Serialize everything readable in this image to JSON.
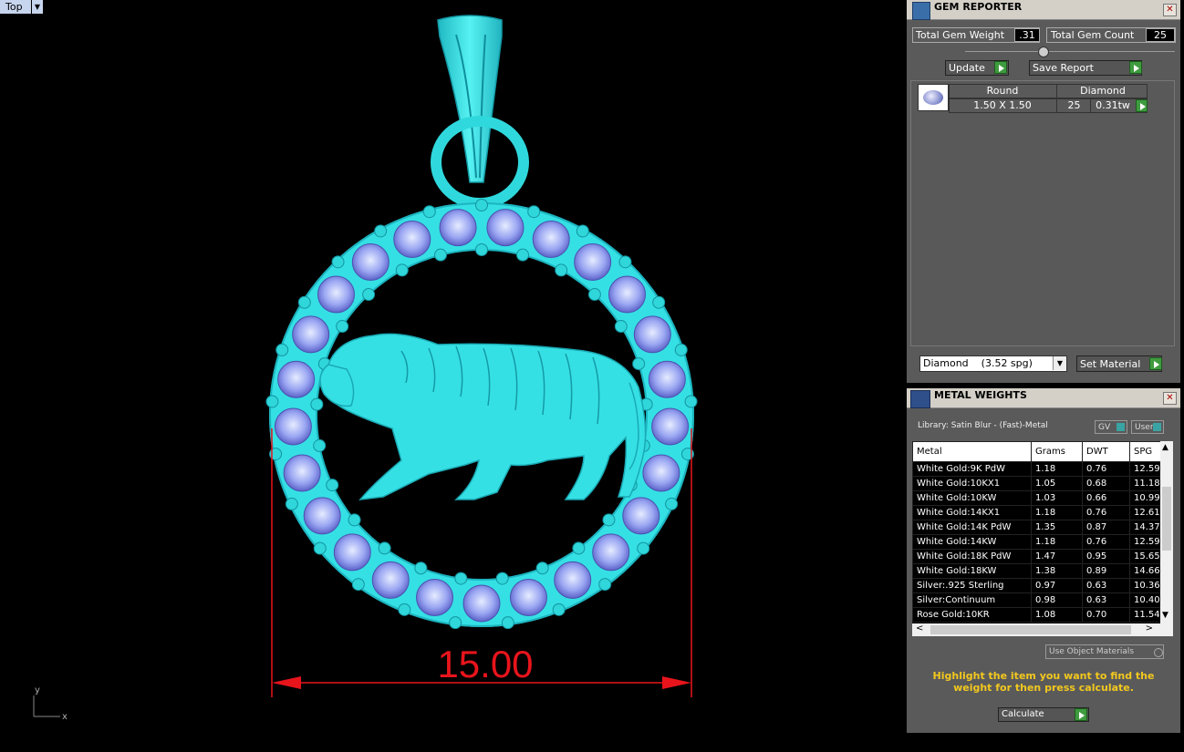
{
  "viewport": {
    "label": "Top",
    "dimension_text": "15.00",
    "axis_x": "x",
    "axis_y": "y"
  },
  "gem_reporter": {
    "title": "GEM REPORTER",
    "total_weight_label": "Total Gem Weight",
    "total_weight_value": ".31",
    "total_count_label": "Total Gem Count",
    "total_count_value": "25",
    "update_label": "Update",
    "save_report_label": "Save Report",
    "gem_row": {
      "shape": "Round",
      "type": "Diamond",
      "size": "1.50 X 1.50",
      "count": "25",
      "weight": "0.31tw"
    },
    "material_select": "Diamond    (3.52 spg)",
    "set_material_label": "Set Material"
  },
  "metal_weights": {
    "title": "METAL WEIGHTS",
    "library": "Library: Satin Blur - (Fast)-Metal",
    "gv_label": "GV",
    "user_label": "User",
    "columns": [
      "Metal",
      "Grams",
      "DWT",
      "SPG"
    ],
    "rows": [
      [
        "White Gold:9K PdW",
        "1.18",
        "0.76",
        "12.59"
      ],
      [
        "White Gold:10KX1",
        "1.05",
        "0.68",
        "11.18"
      ],
      [
        "White Gold:10KW",
        "1.03",
        "0.66",
        "10.99"
      ],
      [
        "White Gold:14KX1",
        "1.18",
        "0.76",
        "12.61"
      ],
      [
        "White Gold:14K PdW",
        "1.35",
        "0.87",
        "14.37"
      ],
      [
        "White Gold:14KW",
        "1.18",
        "0.76",
        "12.59"
      ],
      [
        "White Gold:18K PdW",
        "1.47",
        "0.95",
        "15.65"
      ],
      [
        "White Gold:18KW",
        "1.38",
        "0.89",
        "14.66"
      ],
      [
        "Silver:.925 Sterling",
        "0.97",
        "0.63",
        "10.36"
      ],
      [
        "Silver:Continuum",
        "0.98",
        "0.63",
        "10.40"
      ],
      [
        "Rose Gold:10KR",
        "1.08",
        "0.70",
        "11.54"
      ]
    ],
    "use_object_materials": "Use Object Materials",
    "hint": "Highlight the item you want to find the weight for then press calculate.",
    "calculate_label": "Calculate"
  },
  "colors": {
    "model": "#3fe8e8",
    "dimension": "#e8141c",
    "hint_text": "#f2c81e",
    "panel_bg": "#5a5a5a"
  }
}
